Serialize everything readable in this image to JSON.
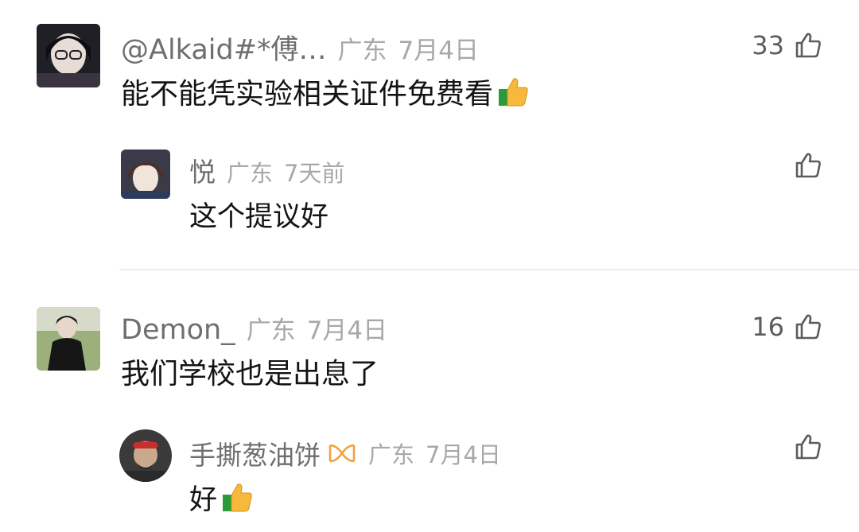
{
  "comments": [
    {
      "username": "@Alkaid#*傅…",
      "location": "广东",
      "date": "7月4日",
      "text": "能不能凭实验相关证件免费看",
      "like_count": "33",
      "replies": [
        {
          "username": "悦",
          "location": "广东",
          "date": "7天前",
          "text": "这个提议好",
          "like_count": ""
        }
      ]
    },
    {
      "username": "Demon_",
      "location": "广东",
      "date": "7月4日",
      "text": "我们学校也是出息了",
      "like_count": "16",
      "replies": [
        {
          "username": "手撕葱油饼",
          "location": "广东",
          "date": "7月4日",
          "text": "好",
          "like_count": ""
        }
      ]
    }
  ]
}
